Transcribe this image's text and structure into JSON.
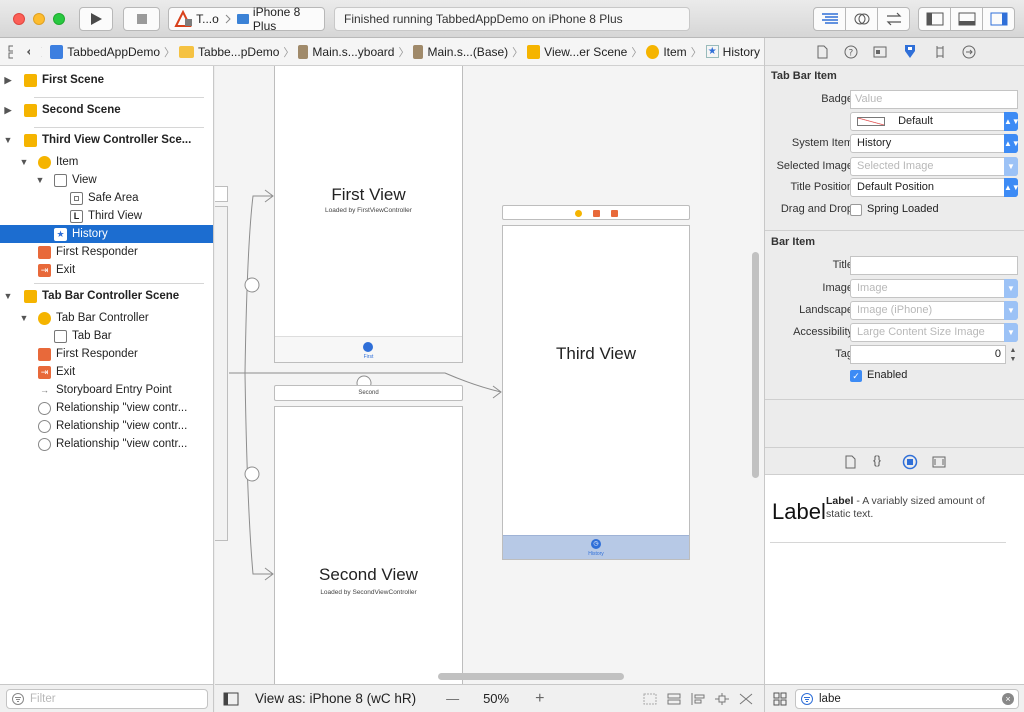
{
  "toolbar": {
    "scheme": "T...o",
    "device": "iPhone 8 Plus",
    "status": "Finished running TabbedAppDemo on iPhone 8 Plus"
  },
  "jumpbar": {
    "crumbs": [
      "TabbedAppDemo",
      "Tabbe...pDemo",
      "Main.s...yboard",
      "Main.s...(Base)",
      "View...er Scene",
      "Item",
      "History"
    ]
  },
  "outline": {
    "first_scene": "First Scene",
    "second_scene": "Second Scene",
    "third_scene": "Third View Controller Sce...",
    "item": "Item",
    "view": "View",
    "safe_area": "Safe Area",
    "third_view": "Third View",
    "history": "History",
    "first_responder": "First Responder",
    "exit": "Exit",
    "tab_bar_scene": "Tab Bar Controller Scene",
    "tab_bar_controller": "Tab Bar Controller",
    "tab_bar": "Tab Bar",
    "first_responder_2": "First Responder",
    "exit_2": "Exit",
    "entry_point": "Storyboard Entry Point",
    "relationships": [
      "Relationship \"view contr...",
      "Relationship \"view contr...",
      "Relationship \"view contr..."
    ],
    "filter_placeholder": "Filter"
  },
  "canvas": {
    "first_view_title": "First View",
    "first_view_subtitle": "Loaded by FirstViewController",
    "first_tab_label": "First",
    "second_header": "Second",
    "second_view_title": "Second View",
    "second_view_subtitle": "Loaded by SecondViewController",
    "third_view_title": "Third View",
    "history_tab_label": "History"
  },
  "bottombar": {
    "view_as": "View as: iPhone 8 (wC hR)",
    "zoom_out": "—",
    "zoom": "50%",
    "zoom_in": "+"
  },
  "inspector": {
    "tab_bar_item_header": "Tab Bar Item",
    "badge_label": "Badge",
    "badge_placeholder": "Value",
    "badge_color": "Default",
    "system_item_label": "System Item",
    "system_item": "History",
    "selected_image_label": "Selected Image",
    "selected_image_placeholder": "Selected Image",
    "title_position_label": "Title Position",
    "title_position": "Default Position",
    "drag_drop_label": "Drag and Drop",
    "spring_loaded": "Spring Loaded",
    "bar_item_header": "Bar Item",
    "title_label": "Title",
    "image_label": "Image",
    "image_placeholder": "Image",
    "landscape_label": "Landscape",
    "landscape_placeholder": "Image (iPhone)",
    "accessibility_label": "Accessibility",
    "accessibility_placeholder": "Large Content Size Image",
    "tag_label": "Tag",
    "tag_value": "0",
    "enabled": "Enabled"
  },
  "library": {
    "item_big": "Label",
    "item_name": "Label",
    "item_desc": " - A variably sized amount of static text.",
    "search_value": "labe"
  },
  "colors": {
    "accent": "#1c6dd0",
    "scene_icon": "#f5b400",
    "tab_selected": "#3d8bf5"
  }
}
